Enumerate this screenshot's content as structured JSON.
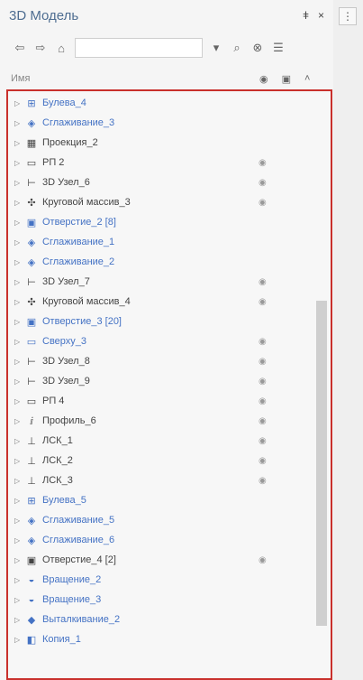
{
  "window": {
    "title": "3D Модель",
    "pin_label": "ǂ",
    "close_label": "×"
  },
  "toolbar": {
    "back_icon": "⇦",
    "forward_icon": "⇨",
    "home_icon": "⌂",
    "search_dropdown": "▾",
    "search_icon": "⌕",
    "filter_icon": "⊗",
    "list_icon": "☰"
  },
  "header": {
    "name_label": "Имя",
    "eye_icon": "◉",
    "layout_icon": "▣",
    "collapse_icon": "˄"
  },
  "tree": [
    {
      "label": "Булева_4",
      "icon": "⊞",
      "color": "blue"
    },
    {
      "label": "Сглаживание_3",
      "icon": "◈",
      "color": "blue"
    },
    {
      "label": "Проекция_2",
      "icon": "▦",
      "color": "dark"
    },
    {
      "label": "РП 2",
      "icon": "▭",
      "color": "dark"
    },
    {
      "label": "3D Узел_6",
      "icon": "⊢",
      "color": "dark"
    },
    {
      "label": "Круговой массив_3",
      "icon": "✣",
      "color": "dark"
    },
    {
      "label": "Отверстие_2 [8]",
      "icon": "▣",
      "color": "blue"
    },
    {
      "label": "Сглаживание_1",
      "icon": "◈",
      "color": "blue"
    },
    {
      "label": "Сглаживание_2",
      "icon": "◈",
      "color": "blue"
    },
    {
      "label": "3D Узел_7",
      "icon": "⊢",
      "color": "dark"
    },
    {
      "label": "Круговой массив_4",
      "icon": "✣",
      "color": "dark"
    },
    {
      "label": "Отверстие_3 [20]",
      "icon": "▣",
      "color": "blue"
    },
    {
      "label": "Сверху_3",
      "icon": "▭",
      "color": "blue"
    },
    {
      "label": "3D Узел_8",
      "icon": "⊢",
      "color": "dark"
    },
    {
      "label": "3D Узел_9",
      "icon": "⊢",
      "color": "dark"
    },
    {
      "label": "РП 4",
      "icon": "▭",
      "color": "dark"
    },
    {
      "label": "Профиль_6",
      "icon": "ⅈ",
      "color": "dark"
    },
    {
      "label": "ЛСК_1",
      "icon": "⊥",
      "color": "dark"
    },
    {
      "label": "ЛСК_2",
      "icon": "⊥",
      "color": "dark"
    },
    {
      "label": "ЛСК_3",
      "icon": "⊥",
      "color": "dark"
    },
    {
      "label": "Булева_5",
      "icon": "⊞",
      "color": "blue"
    },
    {
      "label": "Сглаживание_5",
      "icon": "◈",
      "color": "blue"
    },
    {
      "label": "Сглаживание_6",
      "icon": "◈",
      "color": "blue"
    },
    {
      "label": "Отверстие_4 [2]",
      "icon": "▣",
      "color": "dark"
    },
    {
      "label": "Вращение_2",
      "icon": "◒",
      "color": "blue"
    },
    {
      "label": "Вращение_3",
      "icon": "◒",
      "color": "blue"
    },
    {
      "label": "Выталкивание_2",
      "icon": "◆",
      "color": "blue"
    },
    {
      "label": "Копия_1",
      "icon": "◧",
      "color": "blue"
    }
  ],
  "eye_rows": [
    3,
    4,
    5,
    9,
    10,
    12,
    13,
    14,
    15,
    16,
    17,
    18,
    19,
    23
  ],
  "colors": {
    "accent_blue": "#4472c4",
    "text_dark": "#444444",
    "highlight_border": "#c9302c"
  }
}
